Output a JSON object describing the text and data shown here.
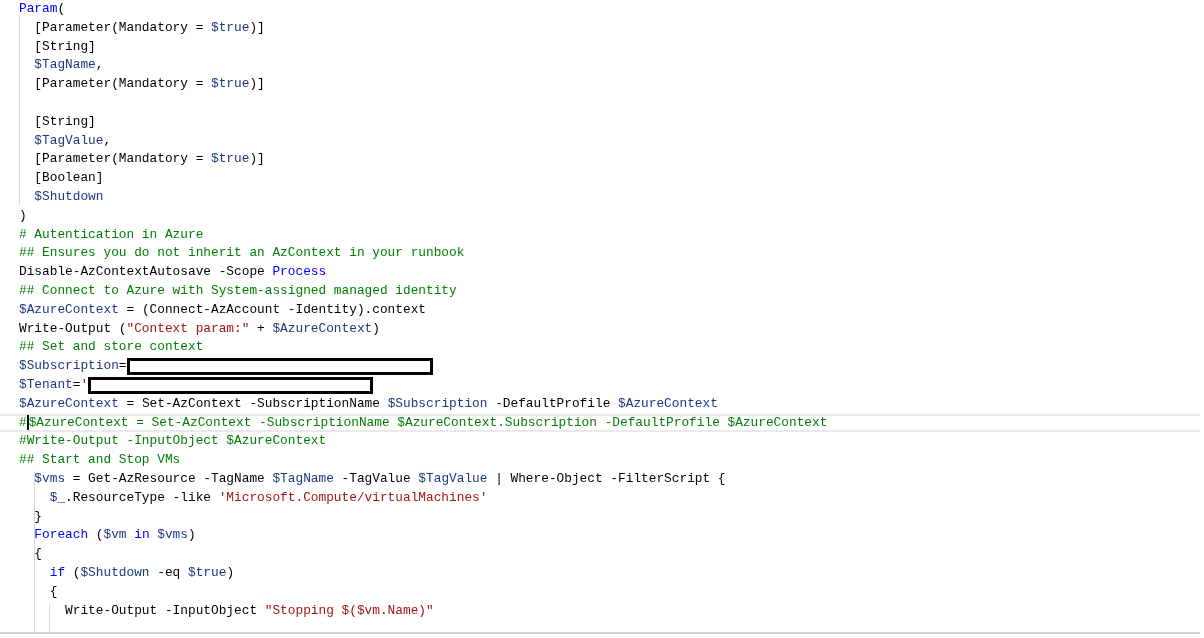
{
  "editor": {
    "lines": [
      {
        "current": false,
        "tokens": [
          {
            "kind": "keyword",
            "text": "Param"
          },
          {
            "kind": "plain",
            "text": "("
          }
        ]
      },
      {
        "current": false,
        "tokens": [
          {
            "kind": "plain",
            "text": "  [Parameter(Mandatory = "
          },
          {
            "kind": "variable",
            "text": "$true"
          },
          {
            "kind": "plain",
            "text": ")]"
          }
        ]
      },
      {
        "current": false,
        "tokens": [
          {
            "kind": "plain",
            "text": "  [String]"
          }
        ]
      },
      {
        "current": false,
        "tokens": [
          {
            "kind": "variable",
            "text": "  $TagName"
          },
          {
            "kind": "plain",
            "text": ","
          }
        ]
      },
      {
        "current": false,
        "tokens": [
          {
            "kind": "plain",
            "text": "  [Parameter(Mandatory = "
          },
          {
            "kind": "variable",
            "text": "$true"
          },
          {
            "kind": "plain",
            "text": ")]"
          }
        ]
      },
      {
        "current": false
      },
      {
        "current": false,
        "tokens": [
          {
            "kind": "plain",
            "text": "  [String]"
          }
        ]
      },
      {
        "current": false,
        "tokens": [
          {
            "kind": "variable",
            "text": "  $TagValue"
          },
          {
            "kind": "plain",
            "text": ","
          }
        ]
      },
      {
        "current": false,
        "tokens": [
          {
            "kind": "plain",
            "text": "  [Parameter(Mandatory = "
          },
          {
            "kind": "variable",
            "text": "$true"
          },
          {
            "kind": "plain",
            "text": ")]"
          }
        ]
      },
      {
        "current": false,
        "tokens": [
          {
            "kind": "plain",
            "text": "  [Boolean]"
          }
        ]
      },
      {
        "current": false,
        "tokens": [
          {
            "kind": "variable",
            "text": "  $Shutdown"
          }
        ]
      },
      {
        "current": false,
        "tokens": [
          {
            "kind": "plain",
            "text": ")"
          }
        ]
      },
      {
        "current": false,
        "tokens": [
          {
            "kind": "comment",
            "text": "# Autentication in Azure"
          }
        ]
      },
      {
        "current": false,
        "tokens": [
          {
            "kind": "comment",
            "text": "## Ensures you do not inherit an AzContext in your runbook"
          }
        ]
      },
      {
        "current": false,
        "tokens": [
          {
            "kind": "plain",
            "text": "Disable-AzContextAutosave -Scope "
          },
          {
            "kind": "keyword",
            "text": "Process"
          }
        ]
      },
      {
        "current": false,
        "tokens": [
          {
            "kind": "comment",
            "text": "## Connect to Azure with System-assigned managed identity"
          }
        ]
      },
      {
        "current": false,
        "tokens": [
          {
            "kind": "variable",
            "text": "$AzureContext"
          },
          {
            "kind": "plain",
            "text": " = (Connect-AzAccount -Identity).context"
          }
        ]
      },
      {
        "current": false,
        "tokens": [
          {
            "kind": "plain",
            "text": "Write-Output ("
          },
          {
            "kind": "string",
            "text": "\"Context param:\""
          },
          {
            "kind": "plain",
            "text": " + "
          },
          {
            "kind": "variable",
            "text": "$AzureContext"
          },
          {
            "kind": "plain",
            "text": ")"
          }
        ]
      },
      {
        "current": false,
        "tokens": [
          {
            "kind": "comment",
            "text": "## Set and store context"
          }
        ]
      },
      {
        "current": false,
        "redacted": true,
        "tokens": [
          {
            "kind": "variable",
            "text": "$Subscription"
          },
          {
            "kind": "plain",
            "text": "="
          }
        ]
      },
      {
        "current": false,
        "redacted": true,
        "tokens": [
          {
            "kind": "variable",
            "text": "$Tenant"
          },
          {
            "kind": "plain",
            "text": "="
          },
          {
            "kind": "string",
            "text": "'"
          }
        ]
      },
      {
        "current": false,
        "tokens": [
          {
            "kind": "variable",
            "text": "$AzureContext"
          },
          {
            "kind": "plain",
            "text": " = Set-AzContext -SubscriptionName "
          },
          {
            "kind": "variable",
            "text": "$Subscription"
          },
          {
            "kind": "plain",
            "text": " -DefaultProfile "
          },
          {
            "kind": "variable",
            "text": "$AzureContext"
          }
        ]
      },
      {
        "current": true,
        "tokens": [
          {
            "kind": "comment",
            "text": "#"
          },
          {
            "kind": "comment",
            "text": "$AzureContext = Set-AzContext -SubscriptionName $AzureContext.Subscription -DefaultProfile $AzureContext"
          }
        ]
      },
      {
        "current": false,
        "tokens": [
          {
            "kind": "comment",
            "text": "#Write-Output -InputObject $AzureContext"
          }
        ]
      },
      {
        "current": false,
        "tokens": [
          {
            "kind": "comment",
            "text": "## Start and Stop VMs"
          }
        ]
      },
      {
        "current": false,
        "tokens": [
          {
            "kind": "variable",
            "text": "  $vms"
          },
          {
            "kind": "plain",
            "text": " = Get-AzResource -TagName "
          },
          {
            "kind": "variable",
            "text": "$TagName"
          },
          {
            "kind": "plain",
            "text": " -TagValue "
          },
          {
            "kind": "variable",
            "text": "$TagValue"
          },
          {
            "kind": "plain",
            "text": " | Where-Object -FilterScript {"
          }
        ]
      },
      {
        "current": false,
        "tokens": [
          {
            "kind": "variable",
            "text": "    $_"
          },
          {
            "kind": "plain",
            "text": ".ResourceType -like "
          },
          {
            "kind": "string",
            "text": "'Microsoft.Compute/virtualMachines'"
          }
        ]
      },
      {
        "current": false,
        "tokens": [
          {
            "kind": "plain",
            "text": "  }"
          }
        ]
      },
      {
        "current": false,
        "tokens": [
          {
            "kind": "keyword",
            "text": "  Foreach"
          },
          {
            "kind": "plain",
            "text": " ("
          },
          {
            "kind": "variable",
            "text": "$vm"
          },
          {
            "kind": "keyword",
            "text": " in "
          },
          {
            "kind": "variable",
            "text": "$vms"
          },
          {
            "kind": "plain",
            "text": ")"
          }
        ]
      },
      {
        "current": false,
        "tokens": [
          {
            "kind": "plain",
            "text": "  {"
          }
        ]
      },
      {
        "current": false,
        "tokens": [
          {
            "kind": "keyword",
            "text": "    if"
          },
          {
            "kind": "plain",
            "text": " ("
          },
          {
            "kind": "variable",
            "text": "$Shutdown"
          },
          {
            "kind": "plain",
            "text": " -eq "
          },
          {
            "kind": "variable",
            "text": "$true"
          },
          {
            "kind": "plain",
            "text": ")"
          }
        ]
      },
      {
        "current": false,
        "tokens": [
          {
            "kind": "plain",
            "text": "    {"
          }
        ]
      },
      {
        "current": false,
        "tokens": [
          {
            "kind": "plain",
            "text": "      Write-Output -InputObject "
          },
          {
            "kind": "string",
            "text": "\"Stopping $($vm.Name)\""
          }
        ]
      }
    ]
  }
}
